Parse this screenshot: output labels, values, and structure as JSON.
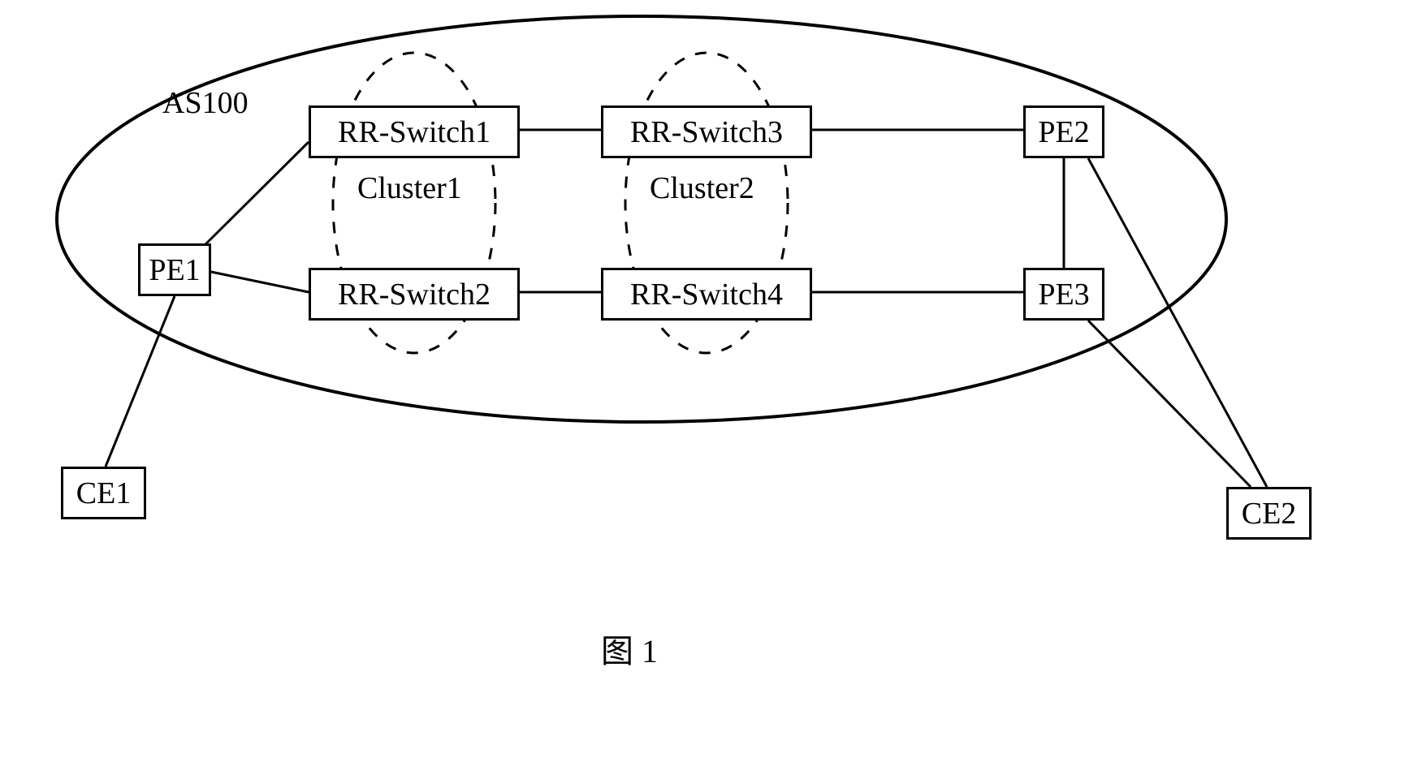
{
  "diagram": {
    "asLabel": "AS100",
    "cluster1Label": "Cluster1",
    "cluster2Label": "Cluster2",
    "caption": "图 1",
    "nodes": {
      "pe1": "PE1",
      "pe2": "PE2",
      "pe3": "PE3",
      "ce1": "CE1",
      "ce2": "CE2",
      "rr1": "RR-Switch1",
      "rr2": "RR-Switch2",
      "rr3": "RR-Switch3",
      "rr4": "RR-Switch4"
    }
  }
}
